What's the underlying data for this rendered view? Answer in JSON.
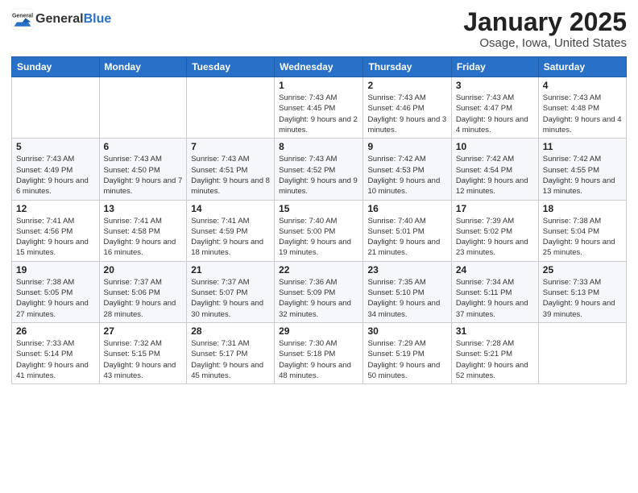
{
  "logo": {
    "general": "General",
    "blue": "Blue"
  },
  "header": {
    "month": "January 2025",
    "location": "Osage, Iowa, United States"
  },
  "weekdays": [
    "Sunday",
    "Monday",
    "Tuesday",
    "Wednesday",
    "Thursday",
    "Friday",
    "Saturday"
  ],
  "weeks": [
    [
      {
        "day": "",
        "info": ""
      },
      {
        "day": "",
        "info": ""
      },
      {
        "day": "",
        "info": ""
      },
      {
        "day": "1",
        "info": "Sunrise: 7:43 AM\nSunset: 4:45 PM\nDaylight: 9 hours and 2 minutes."
      },
      {
        "day": "2",
        "info": "Sunrise: 7:43 AM\nSunset: 4:46 PM\nDaylight: 9 hours and 3 minutes."
      },
      {
        "day": "3",
        "info": "Sunrise: 7:43 AM\nSunset: 4:47 PM\nDaylight: 9 hours and 4 minutes."
      },
      {
        "day": "4",
        "info": "Sunrise: 7:43 AM\nSunset: 4:48 PM\nDaylight: 9 hours and 4 minutes."
      }
    ],
    [
      {
        "day": "5",
        "info": "Sunrise: 7:43 AM\nSunset: 4:49 PM\nDaylight: 9 hours and 6 minutes."
      },
      {
        "day": "6",
        "info": "Sunrise: 7:43 AM\nSunset: 4:50 PM\nDaylight: 9 hours and 7 minutes."
      },
      {
        "day": "7",
        "info": "Sunrise: 7:43 AM\nSunset: 4:51 PM\nDaylight: 9 hours and 8 minutes."
      },
      {
        "day": "8",
        "info": "Sunrise: 7:43 AM\nSunset: 4:52 PM\nDaylight: 9 hours and 9 minutes."
      },
      {
        "day": "9",
        "info": "Sunrise: 7:42 AM\nSunset: 4:53 PM\nDaylight: 9 hours and 10 minutes."
      },
      {
        "day": "10",
        "info": "Sunrise: 7:42 AM\nSunset: 4:54 PM\nDaylight: 9 hours and 12 minutes."
      },
      {
        "day": "11",
        "info": "Sunrise: 7:42 AM\nSunset: 4:55 PM\nDaylight: 9 hours and 13 minutes."
      }
    ],
    [
      {
        "day": "12",
        "info": "Sunrise: 7:41 AM\nSunset: 4:56 PM\nDaylight: 9 hours and 15 minutes."
      },
      {
        "day": "13",
        "info": "Sunrise: 7:41 AM\nSunset: 4:58 PM\nDaylight: 9 hours and 16 minutes."
      },
      {
        "day": "14",
        "info": "Sunrise: 7:41 AM\nSunset: 4:59 PM\nDaylight: 9 hours and 18 minutes."
      },
      {
        "day": "15",
        "info": "Sunrise: 7:40 AM\nSunset: 5:00 PM\nDaylight: 9 hours and 19 minutes."
      },
      {
        "day": "16",
        "info": "Sunrise: 7:40 AM\nSunset: 5:01 PM\nDaylight: 9 hours and 21 minutes."
      },
      {
        "day": "17",
        "info": "Sunrise: 7:39 AM\nSunset: 5:02 PM\nDaylight: 9 hours and 23 minutes."
      },
      {
        "day": "18",
        "info": "Sunrise: 7:38 AM\nSunset: 5:04 PM\nDaylight: 9 hours and 25 minutes."
      }
    ],
    [
      {
        "day": "19",
        "info": "Sunrise: 7:38 AM\nSunset: 5:05 PM\nDaylight: 9 hours and 27 minutes."
      },
      {
        "day": "20",
        "info": "Sunrise: 7:37 AM\nSunset: 5:06 PM\nDaylight: 9 hours and 28 minutes."
      },
      {
        "day": "21",
        "info": "Sunrise: 7:37 AM\nSunset: 5:07 PM\nDaylight: 9 hours and 30 minutes."
      },
      {
        "day": "22",
        "info": "Sunrise: 7:36 AM\nSunset: 5:09 PM\nDaylight: 9 hours and 32 minutes."
      },
      {
        "day": "23",
        "info": "Sunrise: 7:35 AM\nSunset: 5:10 PM\nDaylight: 9 hours and 34 minutes."
      },
      {
        "day": "24",
        "info": "Sunrise: 7:34 AM\nSunset: 5:11 PM\nDaylight: 9 hours and 37 minutes."
      },
      {
        "day": "25",
        "info": "Sunrise: 7:33 AM\nSunset: 5:13 PM\nDaylight: 9 hours and 39 minutes."
      }
    ],
    [
      {
        "day": "26",
        "info": "Sunrise: 7:33 AM\nSunset: 5:14 PM\nDaylight: 9 hours and 41 minutes."
      },
      {
        "day": "27",
        "info": "Sunrise: 7:32 AM\nSunset: 5:15 PM\nDaylight: 9 hours and 43 minutes."
      },
      {
        "day": "28",
        "info": "Sunrise: 7:31 AM\nSunset: 5:17 PM\nDaylight: 9 hours and 45 minutes."
      },
      {
        "day": "29",
        "info": "Sunrise: 7:30 AM\nSunset: 5:18 PM\nDaylight: 9 hours and 48 minutes."
      },
      {
        "day": "30",
        "info": "Sunrise: 7:29 AM\nSunset: 5:19 PM\nDaylight: 9 hours and 50 minutes."
      },
      {
        "day": "31",
        "info": "Sunrise: 7:28 AM\nSunset: 5:21 PM\nDaylight: 9 hours and 52 minutes."
      },
      {
        "day": "",
        "info": ""
      }
    ]
  ]
}
